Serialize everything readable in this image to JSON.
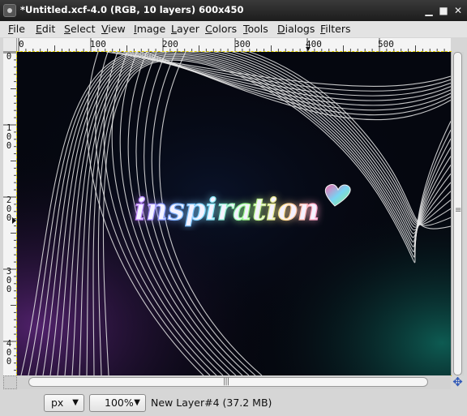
{
  "window": {
    "title": "*Untitled.xcf-4.0 (RGB, 10 layers) 600x450",
    "controls": [
      "minimize",
      "maximize",
      "close"
    ]
  },
  "menubar": [
    "File",
    "Edit",
    "Select",
    "View",
    "Image",
    "Layer",
    "Colors",
    "Tools",
    "Dialogs",
    "Filters"
  ],
  "rulers": {
    "horizontal_labels": [
      "0",
      "100",
      "200",
      "300",
      "400",
      "500"
    ],
    "vertical_labels": [
      "0",
      "100",
      "200",
      "300",
      "400"
    ],
    "unit": "px"
  },
  "canvas": {
    "text": "inspiration",
    "background": "#05070f"
  },
  "statusbar": {
    "unit": "px",
    "zoom": "100%",
    "layer_info": "New Layer#4 (37.2 MB)"
  },
  "colors": {
    "title_bg": "#1c1c1c",
    "menu_bg": "#e3e3e3",
    "selection_outline": "#e6d400",
    "nav_icon": "#2f58b8"
  }
}
